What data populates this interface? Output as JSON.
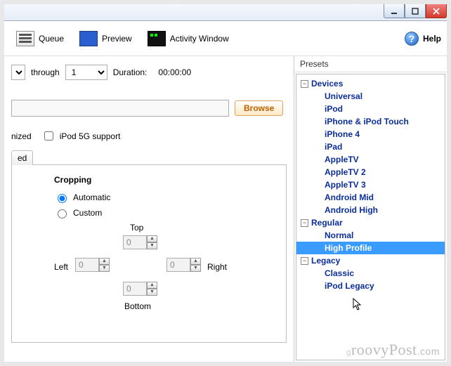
{
  "toolbar": {
    "queue_label": "Queue",
    "preview_label": "Preview",
    "activity_label": "Activity Window",
    "help_label": "Help"
  },
  "chapters": {
    "through_label": "through",
    "through_value": "1",
    "duration_label": "Duration:",
    "duration_value": "00:00:00"
  },
  "source": {
    "browse_label": "Browse"
  },
  "options": {
    "optimized_fragment": "nized",
    "ipod5g_label": "iPod 5G support"
  },
  "tab": {
    "label_fragment": "ed"
  },
  "cropping": {
    "title": "Cropping",
    "auto_label": "Automatic",
    "custom_label": "Custom",
    "top_label": "Top",
    "bottom_label": "Bottom",
    "left_label": "Left",
    "right_label": "Right",
    "top_val": "0",
    "bottom_val": "0",
    "left_val": "0",
    "right_val": "0"
  },
  "presets": {
    "header": "Presets",
    "groups": [
      {
        "name": "Devices",
        "expanded": true,
        "items": [
          "Universal",
          "iPod",
          "iPhone & iPod Touch",
          "iPhone 4",
          "iPad",
          "AppleTV",
          "AppleTV 2",
          "AppleTV 3",
          "Android Mid",
          "Android High"
        ]
      },
      {
        "name": "Regular",
        "expanded": true,
        "items": [
          "Normal",
          "High Profile"
        ]
      },
      {
        "name": "Legacy",
        "expanded": true,
        "items": [
          "Classic",
          "iPod Legacy"
        ]
      }
    ],
    "selected": "High Profile"
  },
  "watermark": "groovyPost.com"
}
